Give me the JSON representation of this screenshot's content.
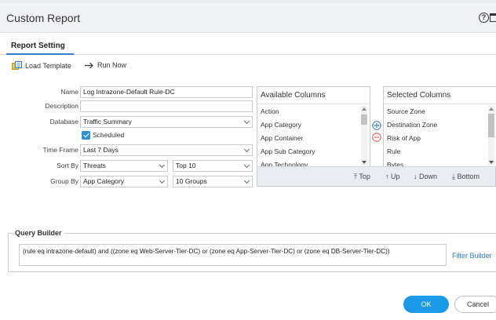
{
  "window": {
    "title": "Custom Report"
  },
  "tabs": [
    {
      "label": "Report Setting"
    }
  ],
  "toolbar": {
    "load_template": "Load Template",
    "run_now": "Run Now"
  },
  "form": {
    "name_label": "Name",
    "name_value": "Log Intrazone-Default Rule-DC",
    "description_label": "Description",
    "description_value": "",
    "database_label": "Database",
    "database_value": "Traffic Summary",
    "scheduled_label": "Scheduled",
    "time_frame_label": "Time Frame",
    "time_frame_value": "Last 7 Days",
    "sort_by_label": "Sort By",
    "sort_by_value": "Threats",
    "sort_top_value": "Top 10",
    "group_by_label": "Group By",
    "group_by_value": "App Category",
    "group_count_value": "10 Groups"
  },
  "available_columns": {
    "title": "Available Columns",
    "items": [
      "Action",
      "App Category",
      "App Container",
      "App Sub Category",
      "App Technology"
    ]
  },
  "selected_columns": {
    "title": "Selected Columns",
    "items": [
      "Source Zone",
      "Destination Zone",
      "Risk of App",
      "Rule",
      "Bytes"
    ]
  },
  "column_actions": {
    "top": "Top",
    "up": "Up",
    "down": "Down",
    "bottom": "Bottom"
  },
  "query_builder": {
    "legend": "Query Builder",
    "query": "(rule eq intrazone-default) and ((zone eq Web-Server-Tier-DC) or (zone eq App-Server-Tier-DC) or (zone eq DB-Server-Tier-DC))",
    "filter_builder": "Filter Builder"
  },
  "footer": {
    "ok": "OK",
    "cancel": "Cancel"
  },
  "colors": {
    "accent": "#1a9ae8",
    "link": "#2d7dd2",
    "remove": "#e05252"
  }
}
